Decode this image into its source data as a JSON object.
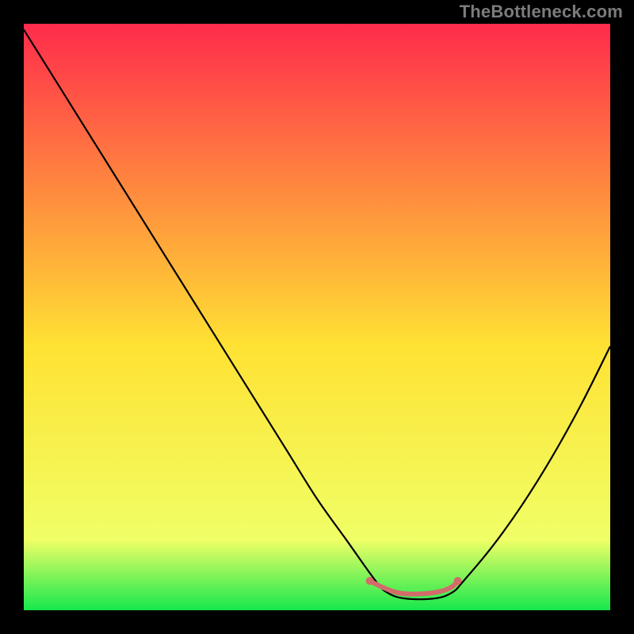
{
  "watermark": "TheBottleneck.com",
  "chart_data": {
    "type": "line",
    "title": "",
    "xlabel": "",
    "ylabel": "",
    "xlim": [
      0,
      100
    ],
    "ylim": [
      0,
      100
    ],
    "grid": false,
    "legend": false,
    "background_gradient": {
      "top_color": "#ff2b4b",
      "mid_color": "#ffe233",
      "bottom_color": "#16e84d"
    },
    "series": [
      {
        "name": "bottleneck-curve",
        "stroke": "#000000",
        "x": [
          0,
          5,
          10,
          15,
          20,
          25,
          30,
          35,
          40,
          45,
          50,
          55,
          60,
          62,
          65,
          70,
          73,
          75,
          80,
          85,
          90,
          95,
          100
        ],
        "values": [
          99,
          91,
          83,
          75,
          67,
          59,
          51,
          43,
          35,
          27,
          19,
          12,
          5,
          3,
          2,
          2,
          3,
          5,
          11,
          18,
          26,
          35,
          45
        ]
      },
      {
        "name": "optimal-band",
        "stroke": "#d36b6b",
        "marker": "dot",
        "x": [
          59,
          61,
          63,
          65,
          68,
          71,
          73,
          74
        ],
        "values": [
          5,
          4,
          3.2,
          2.8,
          2.8,
          3.2,
          4,
          5
        ]
      }
    ]
  }
}
